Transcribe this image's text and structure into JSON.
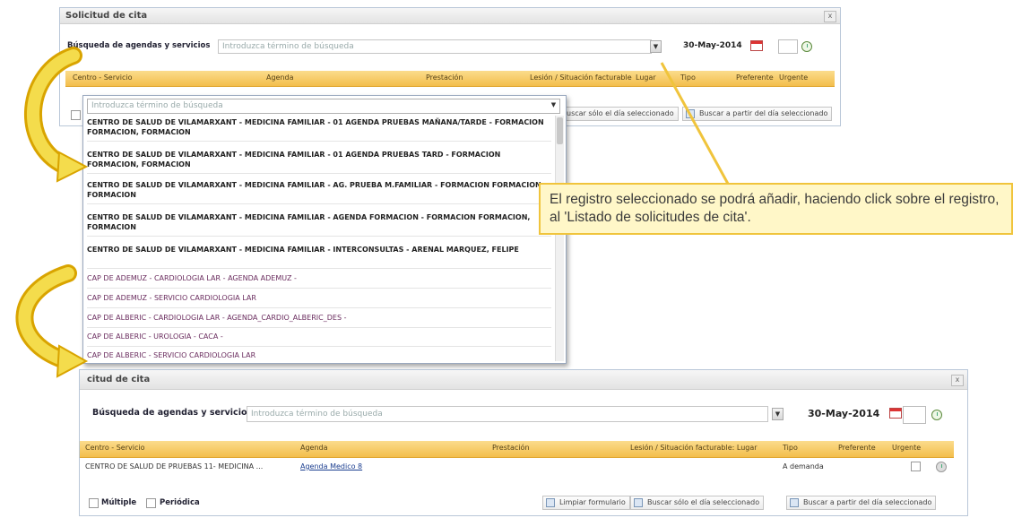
{
  "top_panel": {
    "title": "Solicitud de cita",
    "search_label": "Búsqueda de agendas y servicios",
    "search_placeholder": "Introduzca término de búsqueda",
    "date": "30-May-2014",
    "columns": [
      "Centro - Servicio",
      "Agenda",
      "Prestación",
      "Lesión / Situación facturable",
      "Lugar",
      "Tipo",
      "Preferente",
      "Urgente"
    ],
    "buttons": {
      "search_day": "uscar sólo el día seleccionado",
      "search_from": "Buscar a partir del día seleccionado"
    }
  },
  "dropdown": {
    "placeholder": "Introduzca término de búsqueda",
    "items": [
      {
        "text": "CENTRO DE SALUD DE VILAMARXANT - MEDICINA FAMILIAR - 01 AGENDA PRUEBAS MAÑANA/TARDE - FORMACION FORMACION, FORMACION",
        "style": "b"
      },
      {
        "text": "CENTRO DE SALUD DE VILAMARXANT - MEDICINA FAMILIAR - 01 AGENDA PRUEBAS TARD - FORMACION FORMACION, FORMACION",
        "style": "b"
      },
      {
        "text": "CENTRO DE SALUD DE VILAMARXANT - MEDICINA FAMILIAR - AG. PRUEBA M.FAMILIAR - FORMACION FORMACION, FORMACION",
        "style": "b"
      },
      {
        "text": "CENTRO DE SALUD DE VILAMARXANT - MEDICINA FAMILIAR - AGENDA FORMACION - FORMACION FORMACION, FORMACION",
        "style": "b"
      },
      {
        "text": "CENTRO DE SALUD DE VILAMARXANT - MEDICINA FAMILIAR - INTERCONSULTAS - ARENAL MARQUEZ, FELIPE",
        "style": "b"
      },
      {
        "text": "CAP DE ADEMUZ - CARDIOLOGIA LAR - AGENDA ADEMUZ -",
        "style": "p"
      },
      {
        "text": "CAP DE ADEMUZ - SERVICIO CARDIOLOGIA LAR",
        "style": "p"
      },
      {
        "text": "CAP DE ALBERIC - CARDIOLOGIA LAR - AGENDA_CARDIO_ALBERIC_DES -",
        "style": "p"
      },
      {
        "text": "CAP DE ALBERIC - UROLOGIA - CACA -",
        "style": "p"
      },
      {
        "text": "CAP DE ALBERIC - SERVICIO CARDIOLOGIA LAR",
        "style": "p"
      }
    ]
  },
  "callout": {
    "text": "El registro seleccionado se podrá añadir, haciendo click sobre el registro, al 'Listado de solicitudes de cita'."
  },
  "bottom_panel": {
    "title": "citud de cita",
    "search_label": "Búsqueda de agendas y servicios",
    "search_placeholder": "Introduzca término de búsqueda",
    "date": "30-May-2014",
    "columns": [
      "Centro - Servicio",
      "Agenda",
      "Prestación",
      "Lesión / Situación facturable: Lugar",
      "Tipo",
      "Preferente",
      "Urgente"
    ],
    "row": {
      "centro": "CENTRO DE SALUD DE PRUEBAS 11- MEDICINA ...",
      "agenda": "Agenda Medico 8",
      "tipo": "A demanda"
    },
    "checkbox_multiple": "Múltiple",
    "checkbox_periodica": "Periódica",
    "buttons": {
      "clear": "Limpiar formulario",
      "search_day": "Buscar sólo el día seleccionado",
      "search_from": "Buscar a partir del día seleccionado"
    }
  },
  "colors": {
    "arrow_yellow": "#f4dc4c",
    "arrow_outline": "#d9a400",
    "grid_header": "#f3be4c",
    "callout_bg": "#fff7c8"
  }
}
